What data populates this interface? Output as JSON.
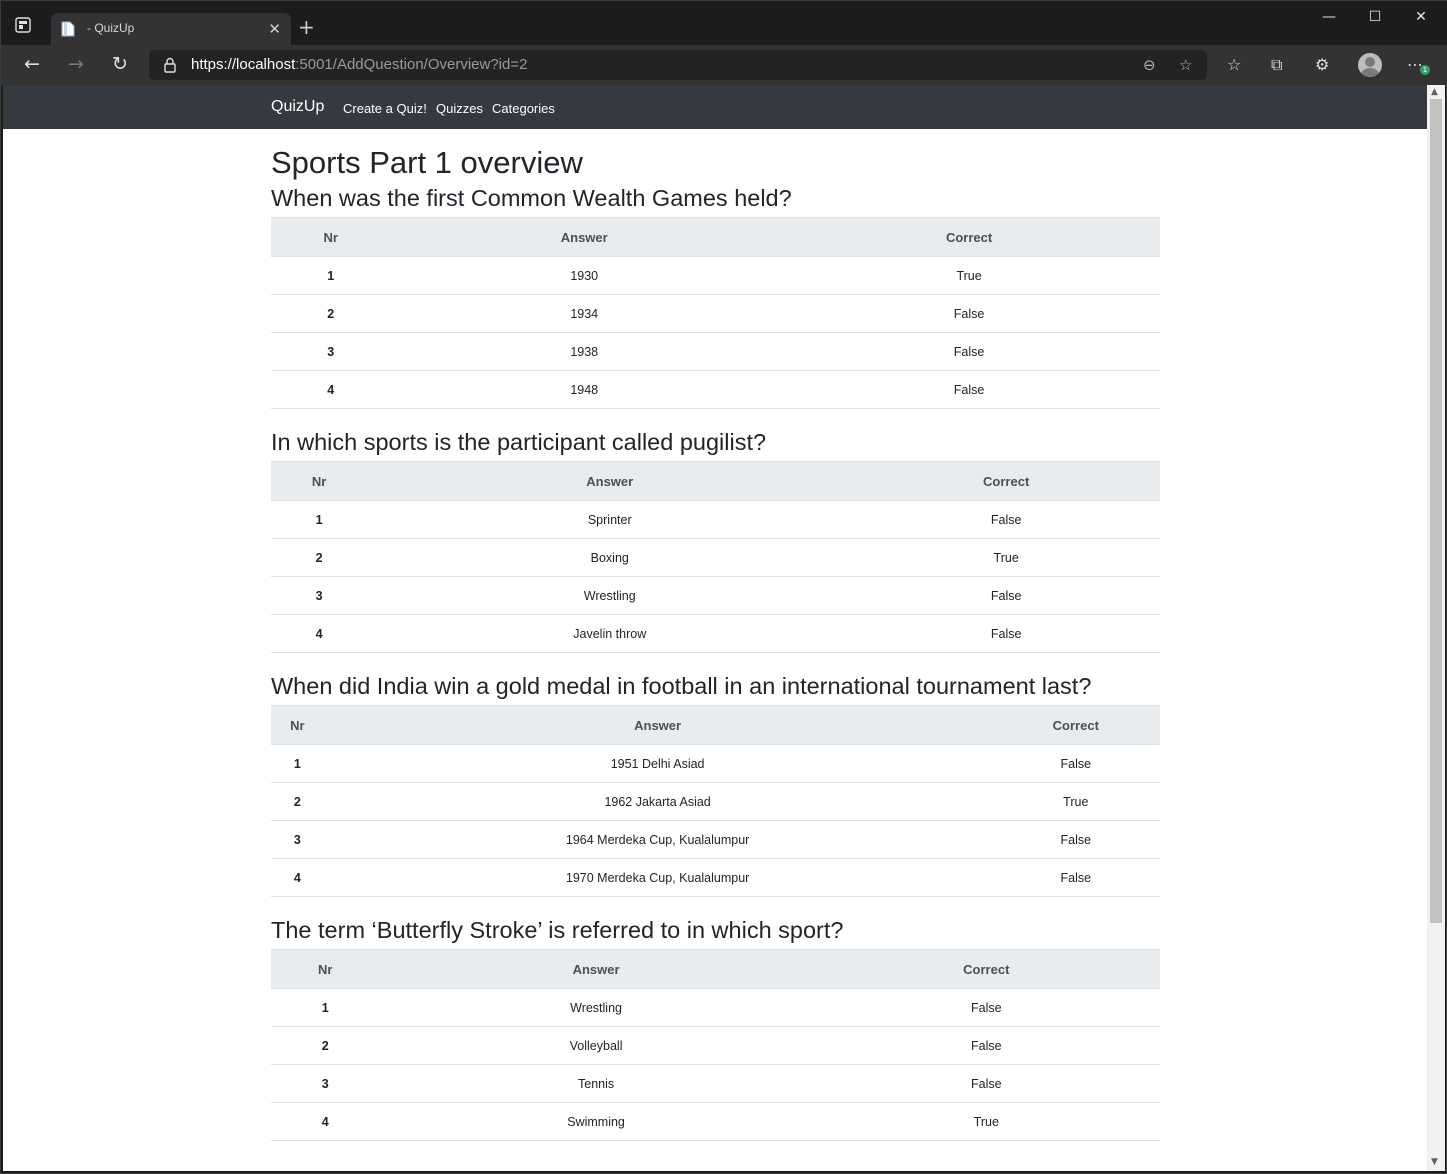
{
  "browser": {
    "tab_title": "- QuizUp",
    "url_prefix": "https://",
    "url_host": "localhost",
    "url_rest": ":5001/AddQuestion/Overview?id=2",
    "notification_count": "1"
  },
  "navbar": {
    "brand": "QuizUp",
    "links": [
      "Create a Quiz!",
      "Quizzes",
      "Categories"
    ]
  },
  "page": {
    "title": "Sports Part 1 overview",
    "table_headers": {
      "nr": "Nr",
      "answer": "Answer",
      "correct": "Correct"
    },
    "questions": [
      {
        "text": "When was the first Common Wealth Games held?",
        "answers": [
          {
            "nr": "1",
            "answer": "1930",
            "correct": "True"
          },
          {
            "nr": "2",
            "answer": "1934",
            "correct": "False"
          },
          {
            "nr": "3",
            "answer": "1938",
            "correct": "False"
          },
          {
            "nr": "4",
            "answer": "1948",
            "correct": "False"
          }
        ]
      },
      {
        "text": "In which sports is the participant called pugilist?",
        "answers": [
          {
            "nr": "1",
            "answer": "Sprinter",
            "correct": "False"
          },
          {
            "nr": "2",
            "answer": "Boxing",
            "correct": "True"
          },
          {
            "nr": "3",
            "answer": "Wrestling",
            "correct": "False"
          },
          {
            "nr": "4",
            "answer": "Javelin throw",
            "correct": "False"
          }
        ]
      },
      {
        "text": "When did India win a gold medal in football in an international tournament last?",
        "answers": [
          {
            "nr": "1",
            "answer": "1951 Delhi Asiad",
            "correct": "False"
          },
          {
            "nr": "2",
            "answer": "1962 Jakarta Asiad",
            "correct": "True"
          },
          {
            "nr": "3",
            "answer": "1964 Merdeka Cup, Kualalumpur",
            "correct": "False"
          },
          {
            "nr": "4",
            "answer": "1970 Merdeka Cup, Kualalumpur",
            "correct": "False"
          }
        ]
      },
      {
        "text": "The term ‘Butterfly Stroke’ is referred to in which sport?",
        "answers": [
          {
            "nr": "1",
            "answer": "Wrestling",
            "correct": "False"
          },
          {
            "nr": "2",
            "answer": "Volleyball",
            "correct": "False"
          },
          {
            "nr": "3",
            "answer": "Tennis",
            "correct": "False"
          },
          {
            "nr": "4",
            "answer": "Swimming",
            "correct": "True"
          }
        ]
      }
    ]
  }
}
